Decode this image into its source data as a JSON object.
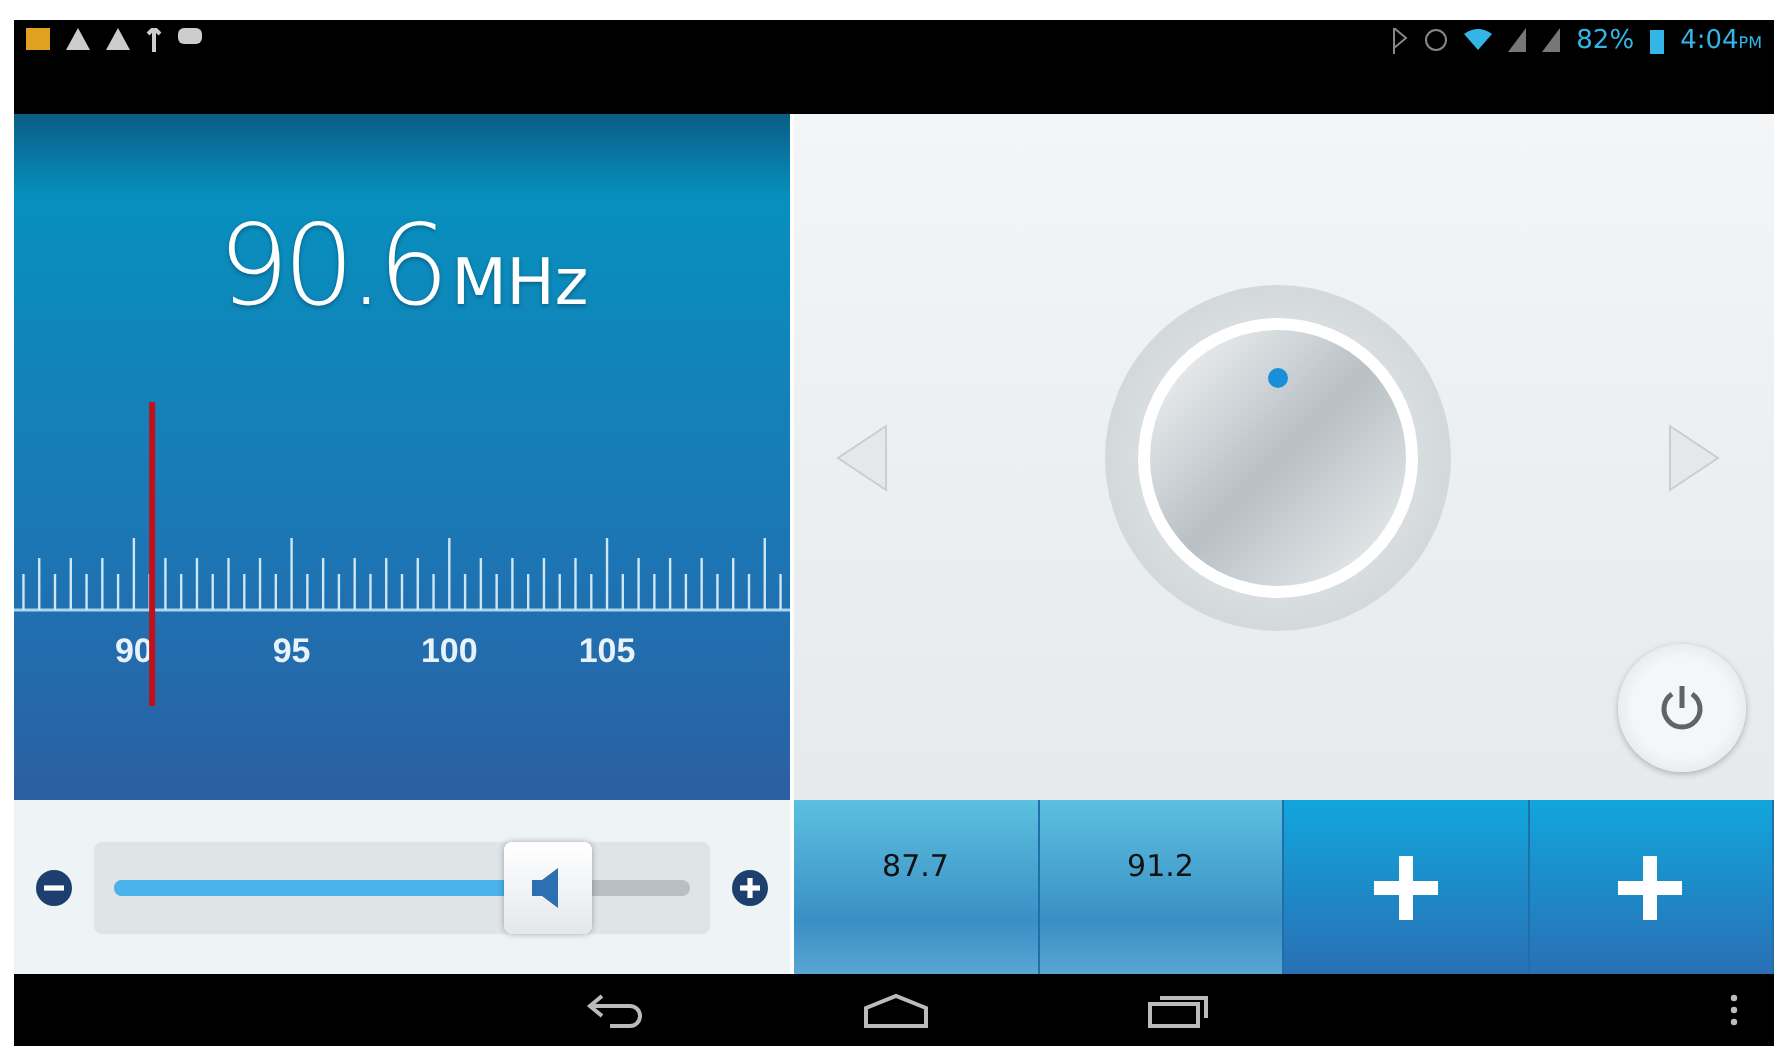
{
  "status_bar": {
    "battery": "82%",
    "time": "4:04",
    "time_suffix": "PM"
  },
  "tuner": {
    "frequency": "90.6",
    "unit": "MHz",
    "scale_labels": [
      "90",
      "95",
      "100",
      "105"
    ],
    "needle": {
      "level": 0.178
    }
  },
  "volume": {
    "level": 0.755
  },
  "presets": [
    {
      "kind": "station",
      "label": "87.7"
    },
    {
      "kind": "station",
      "label": "91.2"
    },
    {
      "kind": "empty"
    },
    {
      "kind": "empty"
    }
  ]
}
